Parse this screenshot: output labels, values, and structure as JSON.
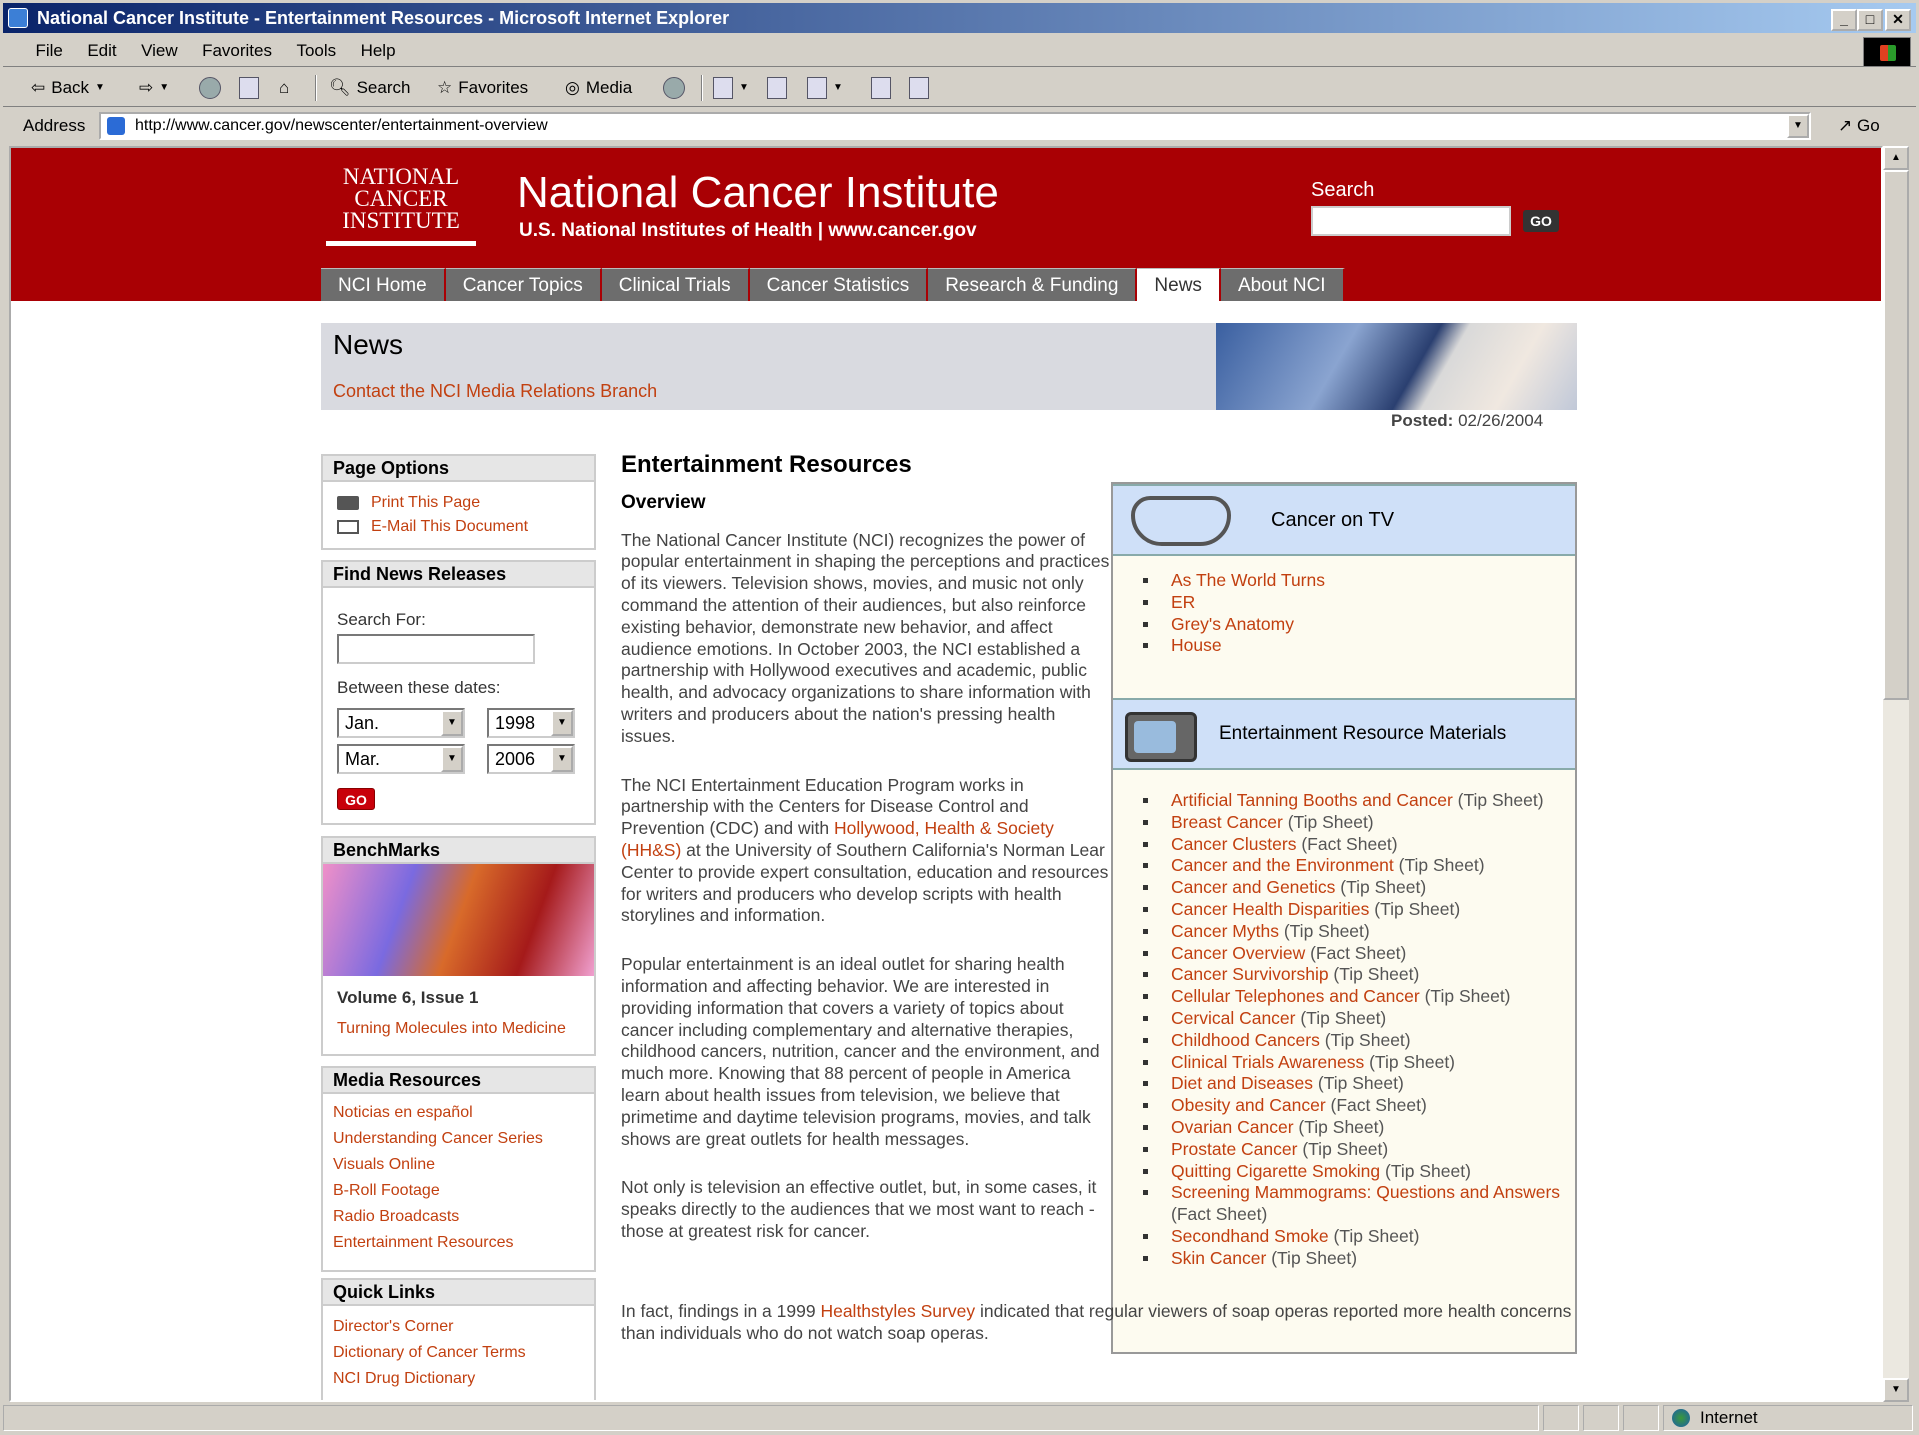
{
  "window": {
    "title": "National Cancer Institute - Entertainment Resources - Microsoft Internet Explorer"
  },
  "menu": [
    "File",
    "Edit",
    "View",
    "Favorites",
    "Tools",
    "Help"
  ],
  "toolbar": {
    "back": "Back",
    "search": "Search",
    "favorites": "Favorites",
    "media": "Media"
  },
  "address": {
    "label": "Address",
    "url": "http://www.cancer.gov/newscenter/entertainment-overview",
    "go": "Go"
  },
  "status": {
    "zone": "Internet"
  },
  "header": {
    "logo": "NATIONAL CANCER INSTITUTE",
    "name": "National Cancer Institute",
    "sub": "U.S. National Institutes of Health  |  www.cancer.gov",
    "search_label": "Search",
    "go": "GO"
  },
  "nav": [
    "NCI Home",
    "Cancer Topics",
    "Clinical Trials",
    "Cancer Statistics",
    "Research & Funding",
    "News",
    "About NCI"
  ],
  "banner": {
    "title": "News",
    "link": "Contact the NCI Media Relations Branch"
  },
  "posted": {
    "label": "Posted:",
    "date": "02/26/2004"
  },
  "page_options": {
    "title": "Page Options",
    "print": "Print This Page",
    "email": "E-Mail This Document"
  },
  "find_news": {
    "title": "Find News Releases",
    "search_for": "Search For:",
    "between": "Between these dates:",
    "month1": "Jan.",
    "year1": "1998",
    "month2": "Mar.",
    "year2": "2006",
    "go": "GO"
  },
  "benchmarks": {
    "title": "BenchMarks",
    "issue": "Volume 6, Issue 1",
    "link": "Turning Molecules into Medicine"
  },
  "media_resources": {
    "title": "Media Resources",
    "items": [
      "Noticias en español",
      "Understanding Cancer Series",
      "Visuals Online",
      "B-Roll Footage",
      "Radio Broadcasts",
      "Entertainment Resources"
    ]
  },
  "quick_links": {
    "title": "Quick Links",
    "items": [
      "Director's Corner",
      "Dictionary of Cancer Terms",
      "NCI Drug Dictionary"
    ]
  },
  "main": {
    "title": "Entertainment Resources",
    "overview": "Overview",
    "p1": "The National Cancer Institute (NCI) recognizes the power of popular entertainment in shaping the perceptions and practices of its viewers. Television shows, movies, and music not only command the attention of their audiences, but also reinforce existing behavior, demonstrate new behavior, and affect audience emotions. In October 2003, the NCI established a partnership with Hollywood executives and academic, public health, and advocacy organizations to share information with writers and producers about the nation's pressing health issues.",
    "p2a": "The NCI Entertainment Education Program works in partnership with the Centers for Disease Control and Prevention (CDC) and with ",
    "p2link": "Hollywood, Health & Society (HH&S)",
    "p2b": " at the University of Southern California's Norman Lear Center to provide expert consultation, education and resources for writers and producers who develop scripts with health storylines and information.",
    "p3": "Popular entertainment is an ideal outlet for sharing health information and affecting behavior. We are interested in providing information that covers a variety of topics about cancer including complementary and alternative therapies, childhood cancers, nutrition, cancer and the environment, and much more. Knowing that 88 percent of people in America learn about health issues from television, we believe that primetime and daytime television programs, movies, and talk shows are great outlets for health messages.",
    "p4a": "Not only is television an effective outlet, but, in some cases, it speaks directly to the audiences that we most want to reach - those at greatest risk for cancer.",
    "p4b": "In fact, findings in a 1999 ",
    "p4link": "Healthstyles Survey",
    "p4c": " indicated that regular viewers of soap operas reported more health concerns than individuals who do not watch soap operas."
  },
  "tv": {
    "title": "Cancer on TV",
    "items": [
      "As The World Turns",
      "ER",
      "Grey's Anatomy",
      "House"
    ]
  },
  "erm": {
    "title": "Entertainment Resource Materials",
    "items": [
      {
        "link": "Artificial Tanning Booths and Cancer",
        "type": " (Tip Sheet)"
      },
      {
        "link": "Breast Cancer",
        "type": " (Tip Sheet)"
      },
      {
        "link": "Cancer Clusters",
        "type": " (Fact Sheet)"
      },
      {
        "link": "Cancer and the Environment",
        "type": " (Tip Sheet)"
      },
      {
        "link": "Cancer and Genetics",
        "type": " (Tip Sheet)"
      },
      {
        "link": "Cancer Health Disparities",
        "type": " (Tip Sheet)"
      },
      {
        "link": "Cancer Myths",
        "type": " (Tip Sheet)"
      },
      {
        "link": "Cancer Overview",
        "type": " (Fact Sheet)"
      },
      {
        "link": "Cancer Survivorship",
        "type": " (Tip Sheet)"
      },
      {
        "link": "Cellular Telephones and Cancer",
        "type": " (Tip Sheet)"
      },
      {
        "link": "Cervical Cancer",
        "type": " (Tip Sheet)"
      },
      {
        "link": "Childhood Cancers",
        "type": " (Tip Sheet)"
      },
      {
        "link": "Clinical Trials Awareness ",
        "type": "(Tip Sheet)"
      },
      {
        "link": "Diet and Diseases",
        "type": " (Tip Sheet)"
      },
      {
        "link": "Obesity and Cancer",
        "type": " (Fact Sheet)"
      },
      {
        "link": "Ovarian Cancer",
        "type": " (Tip Sheet)"
      },
      {
        "link": "Prostate Cancer",
        "type": " (Tip Sheet)"
      },
      {
        "link": "Quitting Cigarette Smoking",
        "type": " (Tip Sheet)"
      },
      {
        "link": "Screening Mammograms: Questions and Answers",
        "type": " (Fact Sheet)"
      },
      {
        "link": "Secondhand Smoke",
        "type": " (Tip Sheet)"
      },
      {
        "link": "Skin Cancer",
        "type": " (Tip Sheet)"
      }
    ]
  }
}
